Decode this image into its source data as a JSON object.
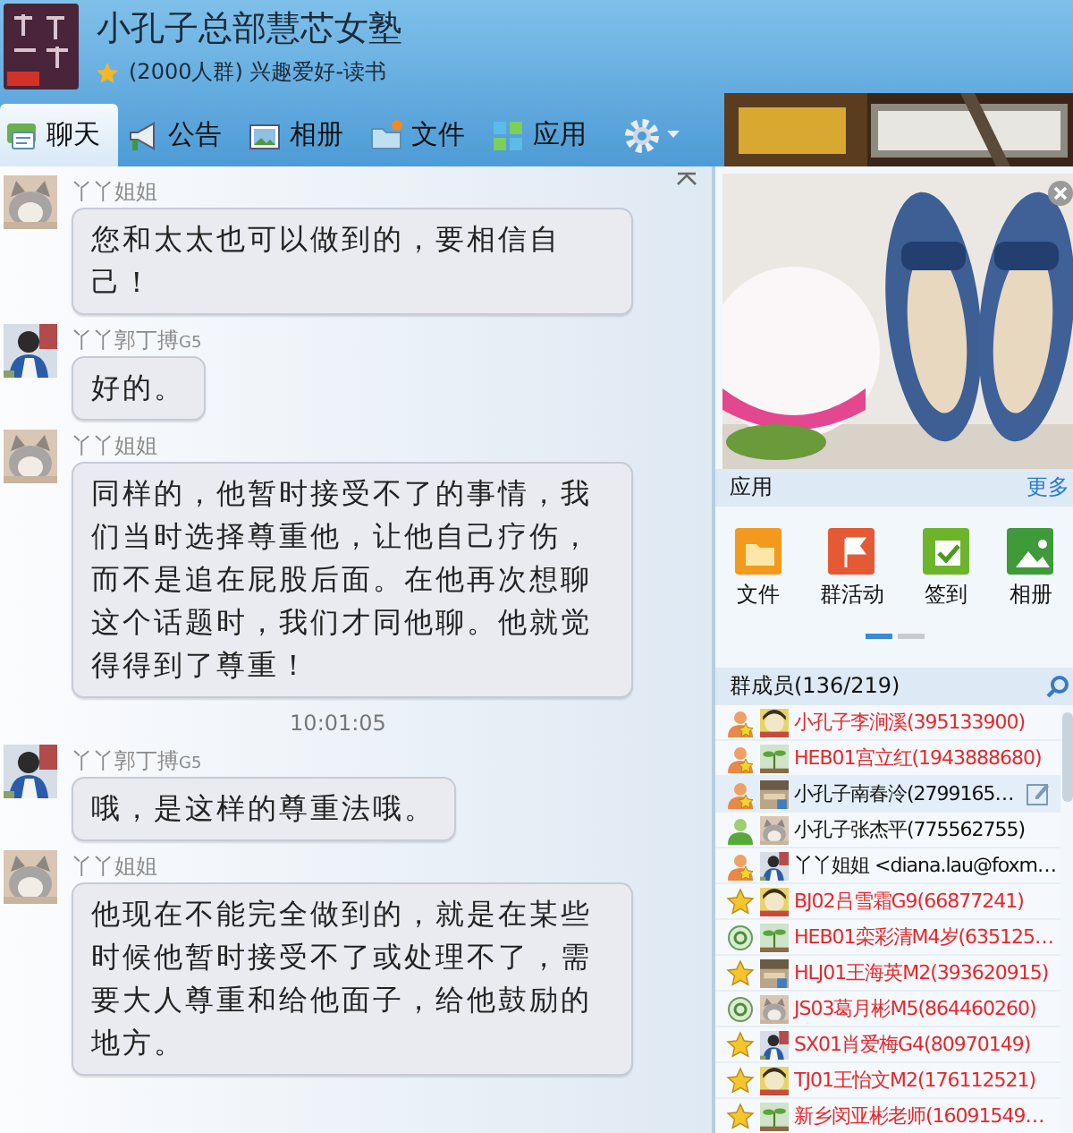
{
  "header": {
    "title": "小孔子总部慧芯女塾",
    "subtitle": "(2000人群) 兴趣爱好-读书"
  },
  "tabs": [
    {
      "label": "聊天",
      "kind": "chat",
      "selected": true
    },
    {
      "label": "公告",
      "kind": "megaphone",
      "selected": false
    },
    {
      "label": "相册",
      "kind": "album",
      "selected": false
    },
    {
      "label": "文件",
      "kind": "folder",
      "selected": false
    },
    {
      "label": "应用",
      "kind": "apps",
      "selected": false
    }
  ],
  "chat": [
    {
      "kind": "message",
      "sender": "丫丫姐姐",
      "text": "您和太太也可以做到的，要相信自己！"
    },
    {
      "kind": "message",
      "sender": "丫丫郭丁搏",
      "badge": "G5",
      "text": "好的。"
    },
    {
      "kind": "message",
      "sender": "丫丫姐姐",
      "text": "同样的，他暂时接受不了的事情，我们当时选择尊重他，让他自己疗伤，而不是追在屁股后面。在他再次想聊这个话题时，我们才同他聊。他就觉得得到了尊重！"
    },
    {
      "kind": "time",
      "text": "10:01:05"
    },
    {
      "kind": "message",
      "sender": "丫丫郭丁搏",
      "badge": "G5",
      "text": "哦，是这样的尊重法哦。"
    },
    {
      "kind": "message",
      "sender": "丫丫姐姐",
      "text": "他现在不能完全做到的，就是在某些时候他暂时接受不了或处理不了，需要大人尊重和给他面子，给他鼓励的地方。"
    }
  ],
  "apps": {
    "title": "应用",
    "more": "更多",
    "items": [
      {
        "label": "文件",
        "kind": "folder"
      },
      {
        "label": "群活动",
        "kind": "flag"
      },
      {
        "label": "签到",
        "kind": "check"
      },
      {
        "label": "相册"
      }
    ]
  },
  "members": {
    "title": "群成员(136/219)",
    "rows": [
      {
        "name": "小孔子李涧溪(395133900)",
        "kind": "admin",
        "color": "#e8262a",
        "hovered": false
      },
      {
        "name": "HEB01宫立红(1943888680)",
        "kind": "admin",
        "color": "#e8262a",
        "hovered": false
      },
      {
        "name": "小孔子南春泠(2799165…",
        "kind": "admin",
        "color": "#111111",
        "hovered": true
      },
      {
        "name": "小孔子张杰平(775562755)",
        "kind": "person",
        "color": "#111111",
        "hovered": false
      },
      {
        "name": "丫丫姐姐 <diana.lau@foxm…",
        "kind": "admin",
        "color": "#111111",
        "hovered": false
      },
      {
        "name": "BJ02吕雪霜G9(66877241)",
        "kind": "star",
        "color": "#e8262a",
        "hovered": false
      },
      {
        "name": "HEB01栾彩清M4岁(635125…",
        "kind": "circle",
        "color": "#e8262a",
        "hovered": false
      },
      {
        "name": "HLJ01王海英M2(393620915)",
        "kind": "star",
        "color": "#e8262a",
        "hovered": false
      },
      {
        "name": "JS03葛月彬M5(864460260)",
        "kind": "circle",
        "color": "#e8262a",
        "hovered": false
      },
      {
        "name": "SX01肖爱梅G4(80970149)",
        "kind": "star",
        "color": "#e8262a",
        "hovered": false
      },
      {
        "name": "TJ01王怡文M2(176112521)",
        "kind": "star",
        "color": "#e8262a",
        "hovered": false
      },
      {
        "name": "新乡闵亚彬老师(16091549…",
        "kind": "star",
        "color": "#e8262a",
        "hovered": false
      }
    ]
  }
}
